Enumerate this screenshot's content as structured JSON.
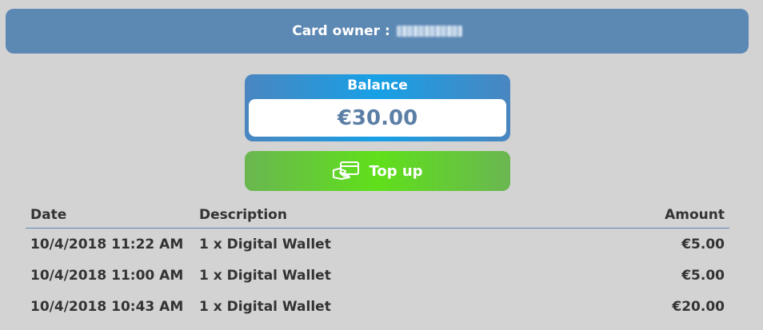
{
  "owner": {
    "label": "Card owner :"
  },
  "balance": {
    "title": "Balance",
    "value": "€30.00"
  },
  "topup": {
    "label": "Top up",
    "icon": "card-payment-icon"
  },
  "transactions": {
    "columns": [
      "Date",
      "Description",
      "Amount"
    ],
    "rows": [
      {
        "date": "10/4/2018 11:22 AM",
        "description": "1 x Digital Wallet",
        "amount": "€5.00"
      },
      {
        "date": "10/4/2018 11:00 AM",
        "description": "1 x Digital Wallet",
        "amount": "€5.00"
      },
      {
        "date": "10/4/2018 10:43 AM",
        "description": "1 x Digital Wallet",
        "amount": "€20.00"
      }
    ]
  },
  "colors": {
    "header_blue": "#5c88b4",
    "balance_blue": "#17a0e6",
    "topup_green": "#5fe01a",
    "background": "#d3d3d3"
  }
}
